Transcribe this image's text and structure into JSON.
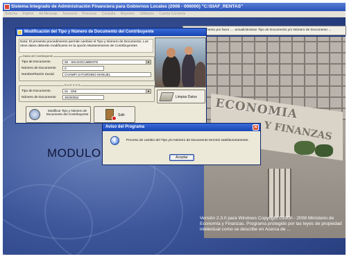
{
  "app": {
    "title": "Sistema Integrado de Administración Financiera para Gobiernos Locales (2008 - 006000)  \"C:\\SIAF_RENTAS\"",
    "menu": [
      "Sistema",
      "Padrón",
      "Ad-Mensaje",
      "Tesorería",
      "Procesos",
      "Consulta",
      "Reportes",
      "Utilitarios",
      "Cuenta Corriente"
    ],
    "status_message": "Espere un momento por favor .... actualizándose Tipo de Documento y/o Número de Documento ...",
    "module_label": "MODULO",
    "building_sign_1": "ECONOMIA",
    "building_sign_2": "Y FINANZAS",
    "version_text": "Versión 2.3.0 para Windows Copyright ©2000 - 2008 Ministerio de Economía y Finanzas. Programa protegido por las leyes de propiedad intelectual como se describe en Acerca de ..."
  },
  "dialog": {
    "title": "Modificación del Tipo y Número de Documento del Contribuyente",
    "note": "Nota: El presente procedimiento permite cambiar el Tipo y Número de Documento. Los otros datos deberán modificarse en la opción Mantenimiento de Contribuyentes",
    "group_current": "Datos del Contribuyente",
    "group_new": "N U E V O S",
    "labels": {
      "doc_type": "Tipo de Documento",
      "doc_number": "Número de Documento",
      "name": "Nombre/Razón Social",
      "new_doc_type": "Tipo de Documento",
      "new_doc_number": "Número de Documento"
    },
    "values": {
      "doc_type": "00 - SIN DOCUMENTO",
      "doc_number": "0",
      "name": "CHAMPI SATURNINO MANUEL",
      "new_doc_type": "01 - DNI",
      "new_doc_number": "30200052"
    },
    "buttons": {
      "limpiar": "Limpiar Datos",
      "modificar": "Modificar Tipo y Número de Documento del Contribuyente",
      "salir": "Salir"
    }
  },
  "msgbox": {
    "title": "Aviso del Programa",
    "text": "Proceso de cambio del Tipo y/o Número de Documento terminó satisfactoriamente.",
    "ok": "Aceptar",
    "close": "✕"
  }
}
